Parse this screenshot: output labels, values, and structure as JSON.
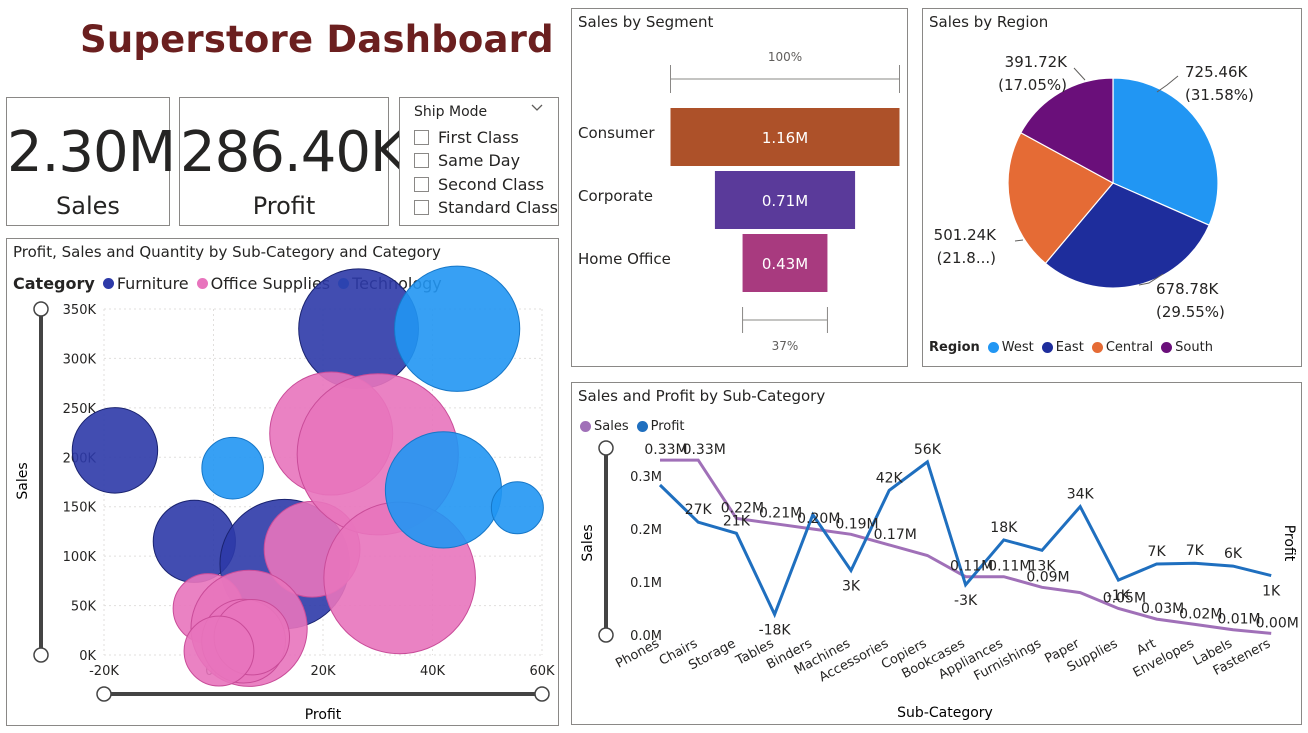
{
  "dashboard": {
    "title": "Superstore Dashboard"
  },
  "kpis": {
    "sales": {
      "value": "2.30M",
      "label": "Sales"
    },
    "profit": {
      "value": "286.40K",
      "label": "Profit"
    }
  },
  "slicer": {
    "title": "Ship Mode",
    "options": [
      "First Class",
      "Same Day",
      "Second Class",
      "Standard Class"
    ]
  },
  "colors": {
    "furniture": "#2d3aa8",
    "office": "#e874bd",
    "technology": "#2196f3",
    "consumer": "#ad5129",
    "corporate": "#5a3a9a",
    "homeoffice": "#a83a7f",
    "west": "#2196f3",
    "east": "#1e2d9c",
    "central": "#e56b35",
    "south": "#6a0f7a",
    "sales_line": "#a070b8",
    "profit_line": "#1f6fbf"
  },
  "chart_data": [
    {
      "type": "scatter",
      "title": "Profit, Sales and Quantity by Sub-Category and Category",
      "xlabel": "Profit",
      "ylabel": "Sales",
      "xlim": [
        -20000,
        60000
      ],
      "ylim": [
        0,
        350000
      ],
      "xticks": [
        "-20K",
        "0K",
        "20K",
        "40K",
        "60K"
      ],
      "yticks": [
        "0K",
        "50K",
        "100K",
        "150K",
        "200K",
        "250K",
        "300K",
        "350K"
      ],
      "legend_title": "Category",
      "legend": [
        "Furniture",
        "Office Supplies",
        "Technology"
      ],
      "legend_placement": "top-left",
      "grid": true,
      "points": [
        {
          "category": "Furniture",
          "x": -18000,
          "y": 207000,
          "quantity": 2700
        },
        {
          "category": "Furniture",
          "x": -3500,
          "y": 115000,
          "quantity": 2500
        },
        {
          "category": "Furniture",
          "x": 13000,
          "y": 92000,
          "quantity": 6200
        },
        {
          "category": "Furniture",
          "x": 26500,
          "y": 330000,
          "quantity": 5300
        },
        {
          "category": "Office Supplies",
          "x": 18000,
          "y": 107000,
          "quantity": 3400
        },
        {
          "category": "Office Supplies",
          "x": 21500,
          "y": 224000,
          "quantity": 5600
        },
        {
          "category": "Office Supplies",
          "x": 30000,
          "y": 203000,
          "quantity": 9600
        },
        {
          "category": "Office Supplies",
          "x": 34000,
          "y": 78000,
          "quantity": 8500
        },
        {
          "category": "Office Supplies",
          "x": -1000,
          "y": 47000,
          "quantity": 1800
        },
        {
          "category": "Office Supplies",
          "x": 6500,
          "y": 27000,
          "quantity": 5000
        },
        {
          "category": "Office Supplies",
          "x": 5500,
          "y": 14000,
          "quantity": 2600
        },
        {
          "category": "Office Supplies",
          "x": 7000,
          "y": 18000,
          "quantity": 2100
        },
        {
          "category": "Office Supplies",
          "x": 1000,
          "y": 4000,
          "quantity": 1800
        },
        {
          "category": "Technology",
          "x": 3500,
          "y": 189000,
          "quantity": 1400
        },
        {
          "category": "Technology",
          "x": 42000,
          "y": 167000,
          "quantity": 5000
        },
        {
          "category": "Technology",
          "x": 44500,
          "y": 330000,
          "quantity": 5800
        },
        {
          "category": "Technology",
          "x": 55500,
          "y": 149000,
          "quantity": 1000
        }
      ]
    },
    {
      "type": "bar",
      "subtype": "funnel",
      "title": "Sales by Segment",
      "categories": [
        "Consumer",
        "Corporate",
        "Home Office"
      ],
      "values": [
        1.16,
        0.71,
        0.43
      ],
      "value_labels": [
        "1.16M",
        "0.71M",
        "0.43M"
      ],
      "unit": "M",
      "top_percent_label": "100%",
      "bottom_percent_label": "37%"
    },
    {
      "type": "pie",
      "title": "Sales by Region",
      "categories": [
        "West",
        "East",
        "Central",
        "South"
      ],
      "values": [
        725.46,
        678.78,
        501.24,
        391.72
      ],
      "unit": "K",
      "percentages": [
        31.58,
        29.55,
        21.82,
        17.05
      ],
      "labels": [
        {
          "value": "725.46K",
          "pct": "(31.58%)"
        },
        {
          "value": "678.78K",
          "pct": "(29.55%)"
        },
        {
          "value": "501.24K",
          "pct": "(21.8...)"
        },
        {
          "value": "391.72K",
          "pct": "(17.05%)"
        }
      ],
      "legend_title": "Region",
      "legend_placement": "bottom-left"
    },
    {
      "type": "line",
      "title": "Sales and Profit by Sub-Category",
      "xlabel": "Sub-Category",
      "ylabel": "Sales",
      "y2label": "Profit",
      "categories": [
        "Phones",
        "Chairs",
        "Storage",
        "Tables",
        "Binders",
        "Machines",
        "Accessories",
        "Copiers",
        "Bookcases",
        "Appliances",
        "Furnishings",
        "Paper",
        "Supplies",
        "Art",
        "Envelopes",
        "Labels",
        "Fasteners"
      ],
      "ylim": [
        0,
        0.3
      ],
      "yticks": [
        "0.0M",
        "0.1M",
        "0.2M",
        "0.3M"
      ],
      "legend_placement": "top-left",
      "series": [
        {
          "name": "Sales",
          "axis": "left",
          "values": [
            0.33,
            0.33,
            0.22,
            0.21,
            0.2,
            0.19,
            0.17,
            0.15,
            0.11,
            0.11,
            0.09,
            0.08,
            0.05,
            0.03,
            0.02,
            0.01,
            0.003
          ],
          "labels": [
            "0.33M",
            "0.33M",
            "0.22M",
            "0.21M",
            "0.20M",
            "0.19M",
            "0.17M",
            "",
            "0.11M",
            "0.11M",
            "0.09M",
            "",
            "0.05M",
            "0.03M",
            "0.02M",
            "0.01M",
            "0.00M"
          ]
        },
        {
          "name": "Profit",
          "axis": "right",
          "values": [
            44.5,
            26.6,
            21.3,
            -17.7,
            30.2,
            3.4,
            41.9,
            55.6,
            -3.5,
            18.1,
            13.1,
            34.1,
            -1.2,
            6.5,
            6.9,
            5.5,
            0.95
          ],
          "unit": "K",
          "labels": [
            "",
            "27K",
            "21K",
            "-18K",
            "",
            "3K",
            "42K",
            "56K",
            "-3K",
            "18K",
            "13K",
            "34K",
            "-1K",
            "7K",
            "7K",
            "6K",
            "1K"
          ]
        }
      ]
    }
  ]
}
